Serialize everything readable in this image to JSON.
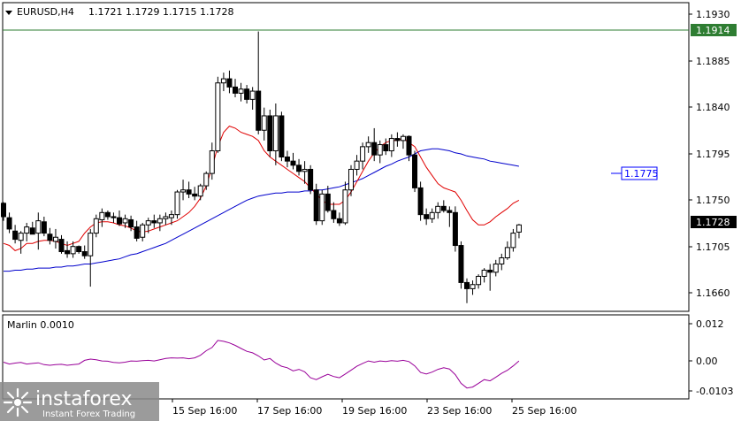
{
  "header": {
    "symbol": "EURUSD,H4",
    "ohlc": "1.1721 1.1729 1.1715 1.1728"
  },
  "marlin": {
    "label": "Marlin 0.0010"
  },
  "price_axis": {
    "ticks": [
      "1.1930",
      "1.1885",
      "1.1840",
      "1.1795",
      "1.1750",
      "1.1705",
      "1.1660"
    ]
  },
  "osc_axis": {
    "ticks": [
      "0.012",
      "0.00",
      "-0.0103"
    ]
  },
  "time_axis": {
    "ticks": [
      "15 Sep 16:00",
      "17 Sep 16:00",
      "19 Sep 16:00",
      "23 Sep 16:00",
      "25 Sep 16:00"
    ]
  },
  "level_line": {
    "value": "1.1914",
    "color": "#2e7d32"
  },
  "ma_blue_label": {
    "value": "1.1775",
    "color": "#0000ff"
  },
  "current_price": {
    "value": "1.1728"
  },
  "watermark": {
    "brand": "instaforex",
    "tagline": "Instant Forex Trading"
  },
  "colors": {
    "ma_red": "#e00000",
    "ma_blue": "#0000cc",
    "oscillator": "#990099",
    "candle": "#000000",
    "grid": "#000000"
  },
  "chart_data": {
    "type": "candlestick",
    "title": "EURUSD,H4",
    "price_range": [
      1.1644,
      1.1944
    ],
    "candles": [
      [
        1.1749,
        1.175,
        1.1732,
        1.1736
      ],
      [
        1.1735,
        1.174,
        1.172,
        1.1724
      ],
      [
        1.1722,
        1.1728,
        1.171,
        1.1714
      ],
      [
        1.1713,
        1.1722,
        1.17,
        1.172
      ],
      [
        1.172,
        1.173,
        1.1712,
        1.1726
      ],
      [
        1.1725,
        1.1731,
        1.1719,
        1.1719
      ],
      [
        1.172,
        1.174,
        1.1704,
        1.1732
      ],
      [
        1.1731,
        1.1736,
        1.1717,
        1.172
      ],
      [
        1.1719,
        1.1725,
        1.1709,
        1.1713
      ],
      [
        1.1712,
        1.1724,
        1.1705,
        1.1716
      ],
      [
        1.1714,
        1.1718,
        1.17,
        1.1702
      ],
      [
        1.1703,
        1.1712,
        1.1696,
        1.17
      ],
      [
        1.17,
        1.1712,
        1.1696,
        1.1707
      ],
      [
        1.1707,
        1.1708,
        1.17,
        1.1702
      ],
      [
        1.1702,
        1.1708,
        1.1695,
        1.1698
      ],
      [
        1.1698,
        1.1724,
        1.1668,
        1.172
      ],
      [
        1.172,
        1.1738,
        1.1716,
        1.1734
      ],
      [
        1.1733,
        1.1744,
        1.1726,
        1.174
      ],
      [
        1.174,
        1.1742,
        1.1733,
        1.1736
      ],
      [
        1.1736,
        1.174,
        1.173,
        1.1735
      ],
      [
        1.1735,
        1.1742,
        1.1727,
        1.1729
      ],
      [
        1.173,
        1.1738,
        1.1725,
        1.1734
      ],
      [
        1.1733,
        1.1737,
        1.1722,
        1.1726
      ],
      [
        1.1726,
        1.1732,
        1.1712,
        1.1715
      ],
      [
        1.1716,
        1.173,
        1.1712,
        1.1728
      ],
      [
        1.1728,
        1.1735,
        1.172,
        1.1732
      ],
      [
        1.1732,
        1.1738,
        1.1725,
        1.173
      ],
      [
        1.173,
        1.1738,
        1.1722,
        1.1734
      ],
      [
        1.1734,
        1.174,
        1.1728,
        1.1736
      ],
      [
        1.1735,
        1.1742,
        1.1728,
        1.1738
      ],
      [
        1.1738,
        1.1762,
        1.1734,
        1.176
      ],
      [
        1.176,
        1.1772,
        1.1752,
        1.1762
      ],
      [
        1.1762,
        1.177,
        1.1754,
        1.1758
      ],
      [
        1.1758,
        1.1765,
        1.1752,
        1.1756
      ],
      [
        1.1756,
        1.1768,
        1.1752,
        1.1766
      ],
      [
        1.1766,
        1.178,
        1.1762,
        1.1778
      ],
      [
        1.1778,
        1.1808,
        1.1772,
        1.18
      ],
      [
        1.18,
        1.1872,
        1.1798,
        1.1866
      ],
      [
        1.1866,
        1.1876,
        1.1858,
        1.187
      ],
      [
        1.187,
        1.1878,
        1.1856,
        1.1862
      ],
      [
        1.1862,
        1.187,
        1.1852,
        1.1856
      ],
      [
        1.1856,
        1.1866,
        1.1848,
        1.186
      ],
      [
        1.186,
        1.1864,
        1.1846,
        1.185
      ],
      [
        1.185,
        1.1862,
        1.184,
        1.1858
      ],
      [
        1.1858,
        1.1916,
        1.1816,
        1.182
      ],
      [
        1.182,
        1.1842,
        1.181,
        1.1834
      ],
      [
        1.1834,
        1.184,
        1.1794,
        1.18
      ],
      [
        1.18,
        1.1846,
        1.1786,
        1.1834
      ],
      [
        1.1834,
        1.1838,
        1.179,
        1.1794
      ],
      [
        1.1794,
        1.18,
        1.1784,
        1.179
      ],
      [
        1.179,
        1.1798,
        1.1782,
        1.1786
      ],
      [
        1.1786,
        1.1792,
        1.1776,
        1.178
      ],
      [
        1.178,
        1.179,
        1.1768,
        1.1782
      ],
      [
        1.1782,
        1.1786,
        1.1758,
        1.1762
      ],
      [
        1.1762,
        1.1768,
        1.1728,
        1.1732
      ],
      [
        1.1732,
        1.1762,
        1.1728,
        1.1758
      ],
      [
        1.1758,
        1.1766,
        1.174,
        1.1742
      ],
      [
        1.1742,
        1.175,
        1.173,
        1.1734
      ],
      [
        1.1734,
        1.174,
        1.1727,
        1.173
      ],
      [
        1.173,
        1.177,
        1.1728,
        1.1762
      ],
      [
        1.1762,
        1.1786,
        1.1756,
        1.1782
      ],
      [
        1.1782,
        1.1796,
        1.1776,
        1.179
      ],
      [
        1.179,
        1.1808,
        1.1782,
        1.1804
      ],
      [
        1.1804,
        1.1814,
        1.1798,
        1.1808
      ],
      [
        1.1808,
        1.1822,
        1.179,
        1.1796
      ],
      [
        1.1796,
        1.181,
        1.1788,
        1.1806
      ],
      [
        1.1806,
        1.1812,
        1.1796,
        1.18
      ],
      [
        1.18,
        1.1816,
        1.1794,
        1.1812
      ],
      [
        1.1812,
        1.1818,
        1.1804,
        1.181
      ],
      [
        1.181,
        1.1816,
        1.1802,
        1.1814
      ],
      [
        1.1814,
        1.1815,
        1.179,
        1.1796
      ],
      [
        1.1796,
        1.18,
        1.176,
        1.1764
      ],
      [
        1.1764,
        1.177,
        1.1732,
        1.1738
      ],
      [
        1.1738,
        1.1744,
        1.1728,
        1.1734
      ],
      [
        1.1734,
        1.1744,
        1.173,
        1.174
      ],
      [
        1.174,
        1.175,
        1.1734,
        1.1746
      ],
      [
        1.1746,
        1.1752,
        1.174,
        1.1742
      ],
      [
        1.1742,
        1.1746,
        1.1726,
        1.174
      ],
      [
        1.174,
        1.1746,
        1.1702,
        1.1708
      ],
      [
        1.1708,
        1.1712,
        1.1666,
        1.1672
      ],
      [
        1.1672,
        1.1676,
        1.1652,
        1.1666
      ],
      [
        1.1666,
        1.1674,
        1.166,
        1.167
      ],
      [
        1.167,
        1.168,
        1.1666,
        1.1678
      ],
      [
        1.1678,
        1.1686,
        1.1672,
        1.1684
      ],
      [
        1.1684,
        1.169,
        1.1664,
        1.1682
      ],
      [
        1.1682,
        1.1694,
        1.1678,
        1.169
      ],
      [
        1.169,
        1.17,
        1.1684,
        1.1696
      ],
      [
        1.1696,
        1.1712,
        1.1694,
        1.1706
      ],
      [
        1.1706,
        1.1724,
        1.1702,
        1.172
      ],
      [
        1.1721,
        1.1729,
        1.1715,
        1.1728
      ]
    ],
    "ma_red": [
      1.171,
      1.1708,
      1.1703,
      1.1705,
      1.171,
      1.171,
      1.1712,
      1.1713,
      1.1713,
      1.1712,
      1.171,
      1.1708,
      1.171,
      1.1712,
      1.172,
      1.1726,
      1.173,
      1.1731,
      1.1731,
      1.173,
      1.1728,
      1.1727,
      1.1725,
      1.1722,
      1.1721,
      1.1722,
      1.1724,
      1.1726,
      1.1728,
      1.173,
      1.1732,
      1.1736,
      1.174,
      1.1746,
      1.1754,
      1.1766,
      1.1784,
      1.1804,
      1.1818,
      1.1824,
      1.1822,
      1.1818,
      1.1816,
      1.1814,
      1.181,
      1.18,
      1.1794,
      1.179,
      1.1786,
      1.1782,
      1.1778,
      1.1774,
      1.177,
      1.1764,
      1.1758,
      1.1752,
      1.1748,
      1.1748,
      1.1748,
      1.1752,
      1.176,
      1.177,
      1.178,
      1.179,
      1.1798,
      1.1804,
      1.1808,
      1.181,
      1.181,
      1.1812,
      1.1808,
      1.1804,
      1.1794,
      1.1784,
      1.1776,
      1.1768,
      1.1764,
      1.1762,
      1.176,
      1.1752,
      1.1742,
      1.1733,
      1.1728,
      1.1728,
      1.1731,
      1.1736,
      1.174,
      1.1744,
      1.1749,
      1.1752
    ],
    "ma_blue": [
      1.1683,
      1.1683,
      1.1684,
      1.1684,
      1.1685,
      1.1685,
      1.1686,
      1.1686,
      1.1686,
      1.1687,
      1.1687,
      1.1688,
      1.1688,
      1.1689,
      1.169,
      1.169,
      1.1691,
      1.1692,
      1.1693,
      1.1694,
      1.1695,
      1.1697,
      1.1699,
      1.17,
      1.1702,
      1.1704,
      1.1706,
      1.1708,
      1.171,
      1.1713,
      1.1716,
      1.1719,
      1.1722,
      1.1725,
      1.1728,
      1.1731,
      1.1734,
      1.1737,
      1.174,
      1.1743,
      1.1746,
      1.1749,
      1.1752,
      1.1754,
      1.1756,
      1.1757,
      1.1758,
      1.1759,
      1.1759,
      1.176,
      1.176,
      1.176,
      1.1761,
      1.1761,
      1.1762,
      1.1762,
      1.1763,
      1.1764,
      1.1765,
      1.1767,
      1.1769,
      1.1771,
      1.1773,
      1.1776,
      1.1779,
      1.1782,
      1.1785,
      1.1787,
      1.179,
      1.1792,
      1.1794,
      1.1797,
      1.18,
      1.1801,
      1.1802,
      1.1802,
      1.1801,
      1.18,
      1.1798,
      1.1797,
      1.1795,
      1.1794,
      1.1793,
      1.1792,
      1.179,
      1.1789,
      1.1788,
      1.1787,
      1.1786,
      1.1785
    ],
    "marlin_range": [
      -0.012,
      0.015
    ],
    "marlin": [
      -0.0002,
      -0.0008,
      -0.0005,
      -0.0003,
      -0.0008,
      -0.0006,
      -0.0004,
      -0.001,
      -0.0012,
      -0.001,
      -0.0009,
      -0.0012,
      -0.001,
      -0.0008,
      0.0004,
      0.0008,
      0.0006,
      0.0002,
      0.0001,
      -0.0003,
      -0.0004,
      -0.0002,
      0.0002,
      0.0001,
      0.0003,
      0.0004,
      0.0002,
      0.0006,
      0.001,
      0.0012,
      0.0011,
      0.0012,
      0.0009,
      0.0012,
      0.002,
      0.0035,
      0.0045,
      0.0068,
      0.0065,
      0.006,
      0.0052,
      0.0042,
      0.0033,
      0.0028,
      0.0018,
      0.0005,
      0.001,
      -0.0005,
      -0.0015,
      -0.002,
      -0.003,
      -0.0025,
      -0.0033,
      -0.0052,
      -0.0058,
      -0.0049,
      -0.0041,
      -0.0048,
      -0.0052,
      -0.004,
      -0.0028,
      -0.0015,
      -0.0006,
      0.0002,
      -0.0002,
      0.0002,
      0.0,
      0.0003,
      0.0001,
      0.0004,
      0.0,
      -0.0014,
      -0.0035,
      -0.004,
      -0.0034,
      -0.0025,
      -0.002,
      -0.0024,
      -0.0042,
      -0.007,
      -0.0085,
      -0.0082,
      -0.007,
      -0.0058,
      -0.0062,
      -0.005,
      -0.0038,
      -0.0028,
      -0.0014,
      0.0002
    ]
  }
}
